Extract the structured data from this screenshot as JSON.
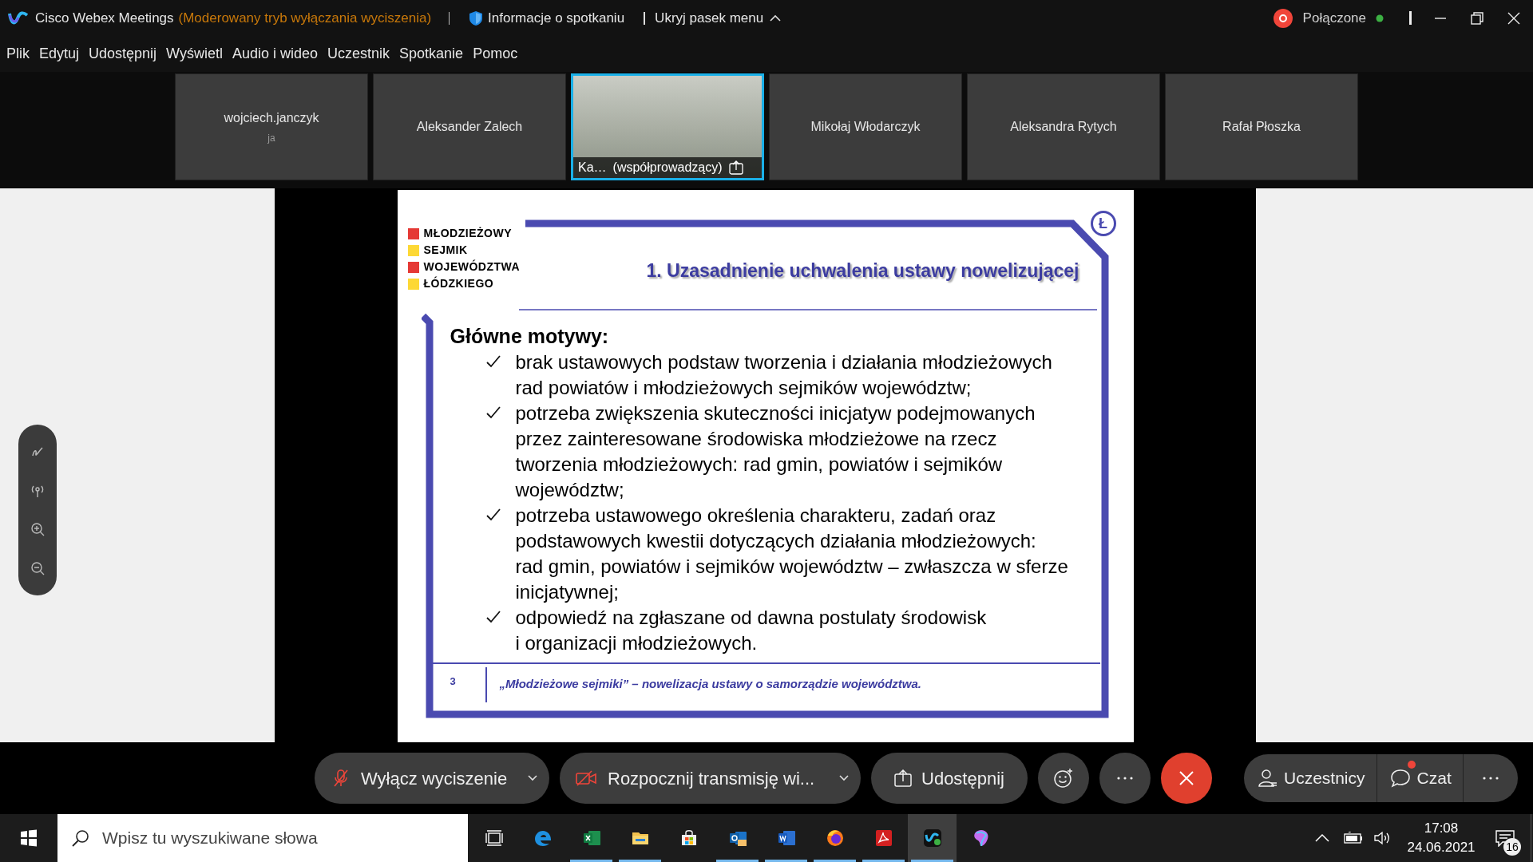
{
  "window": {
    "app_name": "Cisco Webex Meetings",
    "mode": "(Moderowany tryb wyłączania wyciszenia)",
    "meeting_info": "Informacje o spotkaniu",
    "hide_menu": "Ukryj pasek menu",
    "recording_status": "Połączone",
    "connected": true
  },
  "menu": [
    "Plik",
    "Edytuj",
    "Udostępnij",
    "Wyświetl",
    "Audio i wideo",
    "Uczestnik",
    "Spotkanie",
    "Pomoc"
  ],
  "participants": [
    {
      "name": "wojciech.janczyk",
      "subtitle": "ja",
      "video": false,
      "selected": false
    },
    {
      "name": "Aleksander Zalech",
      "video": false,
      "selected": false
    },
    {
      "name": "Ka…",
      "role": "(współprowadzący)",
      "video": true,
      "sharing": true,
      "selected": true
    },
    {
      "name": "Mikołaj Włodarczyk",
      "video": false,
      "selected": false
    },
    {
      "name": "Aleksandra Rytych",
      "video": false,
      "selected": false
    },
    {
      "name": "Rafał Płoszka",
      "video": false,
      "selected": false
    }
  ],
  "slide": {
    "logo": [
      {
        "text": "MŁODZIEŻOWY",
        "color": "#e53935"
      },
      {
        "text": "SEJMIK",
        "color": "#fdd835"
      },
      {
        "text": "WOJEWÓDZTWA",
        "color": "#e53935"
      },
      {
        "text": "ŁÓDZKIEGO",
        "color": "#fdd835"
      }
    ],
    "badge": "Ł",
    "title": "1. Uzasadnienie uchwalenia ustawy nowelizującej",
    "heading": "Główne motywy:",
    "items": [
      {
        "lines": [
          "brak ustawowych podstaw tworzenia i działania młodzieżowych",
          "rad powiatów i młodzieżowych sejmików województw;"
        ]
      },
      {
        "lines": [
          "potrzeba zwiększenia skuteczności inicjatyw podejmowanych",
          "przez zainteresowane środowiska młodzieżowe na rzecz",
          "tworzenia młodzieżowych: rad gmin, powiatów i sejmików",
          "województw;"
        ]
      },
      {
        "lines": [
          "potrzeba ustawowego określenia charakteru, zadań oraz",
          "podstawowych kwestii dotyczących działania młodzieżowych:",
          "rad gmin, powiatów i sejmików województw – zwłaszcza w sferze",
          "inicjatywnej;"
        ]
      },
      {
        "lines": [
          "odpowiedź na zgłaszane od dawna postulaty środowisk",
          "i organizacji młodzieżowych."
        ]
      }
    ],
    "page": "3",
    "footer": "„Młodzieżowe sejmiki” – nowelizacja ustawy o samorządzie województwa."
  },
  "annotation_tools": [
    {
      "kind": "pen"
    },
    {
      "kind": "pointer"
    },
    {
      "kind": "zoom-in"
    },
    {
      "kind": "zoom-out"
    }
  ],
  "controls": {
    "mute": {
      "label": "Wyłącz wyciszenie",
      "muted": true
    },
    "video": {
      "label": "Rozpocznij transmisję wi...",
      "off": true
    },
    "share": "Udostępnij",
    "participants": "Uczestnicy",
    "chat": {
      "label": "Czat",
      "unread": true
    }
  },
  "taskbar": {
    "search": {
      "placeholder": "Wpisz tu wyszukiwane słowa"
    },
    "apps": [
      {
        "kind": "taskview",
        "running": false,
        "active": false
      },
      {
        "kind": "edge",
        "running": false,
        "active": false
      },
      {
        "kind": "excel",
        "running": true,
        "active": false
      },
      {
        "kind": "explorer",
        "running": true,
        "active": false
      },
      {
        "kind": "store",
        "running": false,
        "active": false
      },
      {
        "kind": "outlook",
        "running": true,
        "active": false
      },
      {
        "kind": "word",
        "running": true,
        "active": false
      },
      {
        "kind": "firefox",
        "running": true,
        "active": false
      },
      {
        "kind": "acrobat",
        "running": true,
        "active": false
      },
      {
        "kind": "webex",
        "running": true,
        "active": true
      },
      {
        "kind": "paint",
        "running": false,
        "active": false
      }
    ],
    "time": "17:08",
    "date": "24.06.2021",
    "notifications": "16"
  }
}
